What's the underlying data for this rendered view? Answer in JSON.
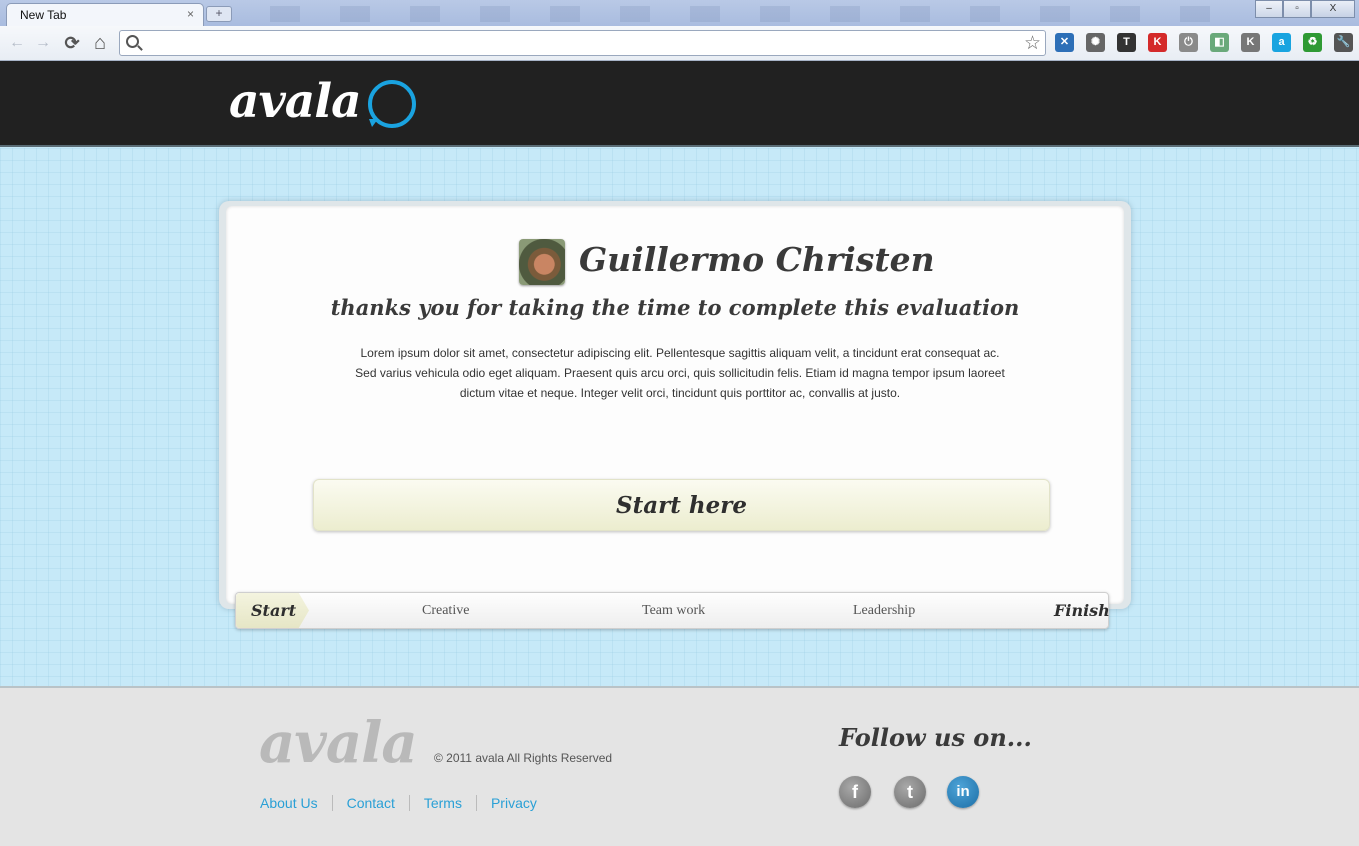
{
  "browser": {
    "tab_title": "New Tab",
    "tab_close": "×",
    "new_tab": "+",
    "window_controls": [
      "–",
      "▫",
      "X"
    ],
    "omnibox_value": "",
    "back_icon": "←",
    "forward_icon": "→",
    "reload_icon": "⟳",
    "home_icon": "⌂",
    "bookmark_icon": "☆",
    "extensions": [
      {
        "name": "x-icon",
        "glyph": "✕",
        "color": "#2d6fb7"
      },
      {
        "name": "gear-icon",
        "glyph": "✺",
        "color": "#666666"
      },
      {
        "name": "t-icon",
        "glyph": "T",
        "color": "#333333"
      },
      {
        "name": "k-red-icon",
        "glyph": "K",
        "color": "#d42a2a"
      },
      {
        "name": "power-icon",
        "glyph": "⏻",
        "color": "#8a8a8a"
      },
      {
        "name": "squares-icon",
        "glyph": "◧",
        "color": "#6aa97a"
      },
      {
        "name": "k-icon",
        "glyph": "K",
        "color": "#777777"
      },
      {
        "name": "a-icon",
        "glyph": "a",
        "color": "#19a4e0"
      },
      {
        "name": "recycle-icon",
        "glyph": "♻",
        "color": "#2f9a34"
      },
      {
        "name": "wrench-icon",
        "glyph": "🔧",
        "color": "#555555"
      }
    ]
  },
  "header": {
    "logo": "avala",
    "brand_color": "#1aa3e0"
  },
  "evaluation": {
    "name": "Guillermo Christen",
    "thanks": "thanks you for taking the time to complete this evaluation",
    "body": "Lorem ipsum dolor sit amet, consectetur adipiscing elit. Pellentesque sagittis aliquam velit, a tincidunt erat consequat ac. Sed varius vehicula odio eget aliquam. Praesent quis arcu orci, quis sollicitudin felis. Etiam id magna tempor ipsum laoreet dictum vitae et neque. Integer velit orci, tincidunt quis porttitor ac, convallis at justo.",
    "start_button": "Start here"
  },
  "progress": {
    "start": "Start",
    "steps": [
      "Creative",
      "Team work",
      "Leadership"
    ],
    "finish": "Finish"
  },
  "footer": {
    "logo": "avala",
    "copyright": "© 2011 avala All Rights Reserved",
    "links": [
      "About Us",
      "Contact",
      "Terms",
      "Privacy"
    ],
    "follow": "Follow us on...",
    "social": [
      {
        "name": "facebook-icon",
        "glyph": "f"
      },
      {
        "name": "twitter-icon",
        "glyph": "t"
      },
      {
        "name": "linkedin-icon",
        "glyph": "in"
      }
    ]
  }
}
